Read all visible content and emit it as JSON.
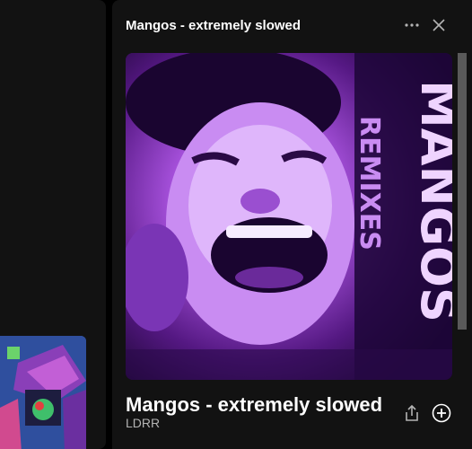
{
  "panel": {
    "header_title": "Mangos - extremely slowed",
    "more_options_icon": "more-options-icon",
    "close_icon": "close-icon"
  },
  "track": {
    "title": "Mangos - extremely slowed",
    "artist": "LDRR",
    "share_icon": "share-icon",
    "add_icon": "add-to-library-icon"
  },
  "colors": {
    "background": "#000000",
    "panel": "#121212",
    "text_primary": "#ffffff",
    "text_secondary": "#b3b3b3",
    "cover_accent": "#a530e8"
  }
}
